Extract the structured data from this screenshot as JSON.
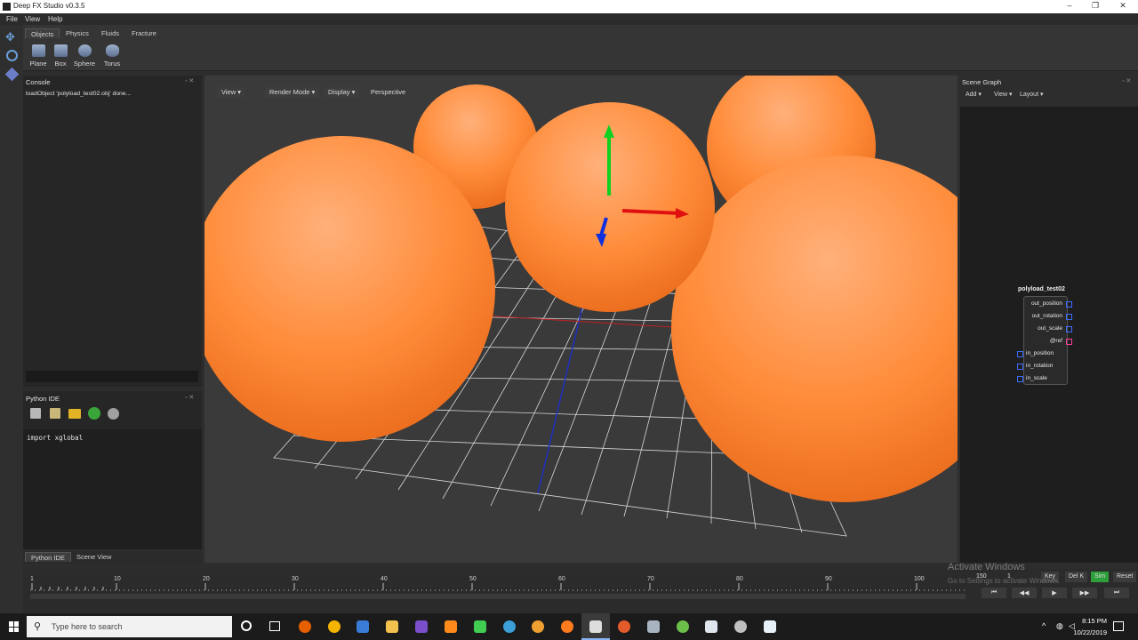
{
  "window": {
    "title": "Deep FX Studio v0.3.5",
    "minimize": "–",
    "restore": "❐",
    "close": "✕"
  },
  "menu": [
    "File",
    "View",
    "Help"
  ],
  "shelf": {
    "tabs": [
      "Objects",
      "Physics",
      "Fluids",
      "Fracture"
    ],
    "items": [
      "Plane",
      "Box",
      "Sphere",
      "Torus"
    ]
  },
  "console": {
    "title": "Console",
    "log": "loadObject 'polyload_test02.obj' done..."
  },
  "python_ide": {
    "title": "Python IDE",
    "code": "import xglobal"
  },
  "bottom_tabs": [
    "Python IDE",
    "Scene View"
  ],
  "viewport": {
    "buttons": [
      "View",
      "Render Mode",
      "Display"
    ],
    "mode": "Perspective"
  },
  "scene_graph": {
    "title": "Scene Graph",
    "menu": [
      "Add",
      "View",
      "Layout"
    ],
    "node": {
      "name": "polyload_test02",
      "outputs": [
        "out_position",
        "out_rotation",
        "out_scale",
        "@ref"
      ],
      "inputs": [
        "in_position",
        "in_rotation",
        "in_scale"
      ]
    }
  },
  "timeline": {
    "ticks": [
      "1",
      "10",
      "20",
      "30",
      "40",
      "50",
      "60",
      "70",
      "80",
      "90",
      "100"
    ],
    "end_frame": "150",
    "current": "1",
    "buttons": [
      "Key",
      "Del K",
      "Sim",
      "Reset"
    ],
    "playback": [
      "⏮",
      "◀◀",
      "▶",
      "▶▶",
      "⏭"
    ]
  },
  "watermark": {
    "line1": "Activate Windows",
    "line2": "Go to Settings to activate Windows."
  },
  "taskbar": {
    "search_placeholder": "Type here to search",
    "time": "8:15 PM",
    "date": "10/22/2019"
  },
  "colors": {
    "sphere": "#ff8c3a",
    "axis_x": "#e01010",
    "axis_y": "#10d020",
    "axis_z": "#1030e0",
    "port_in": "#3b6cff",
    "port_ref": "#ff3b9c",
    "sim_button": "#2e9e3a"
  }
}
